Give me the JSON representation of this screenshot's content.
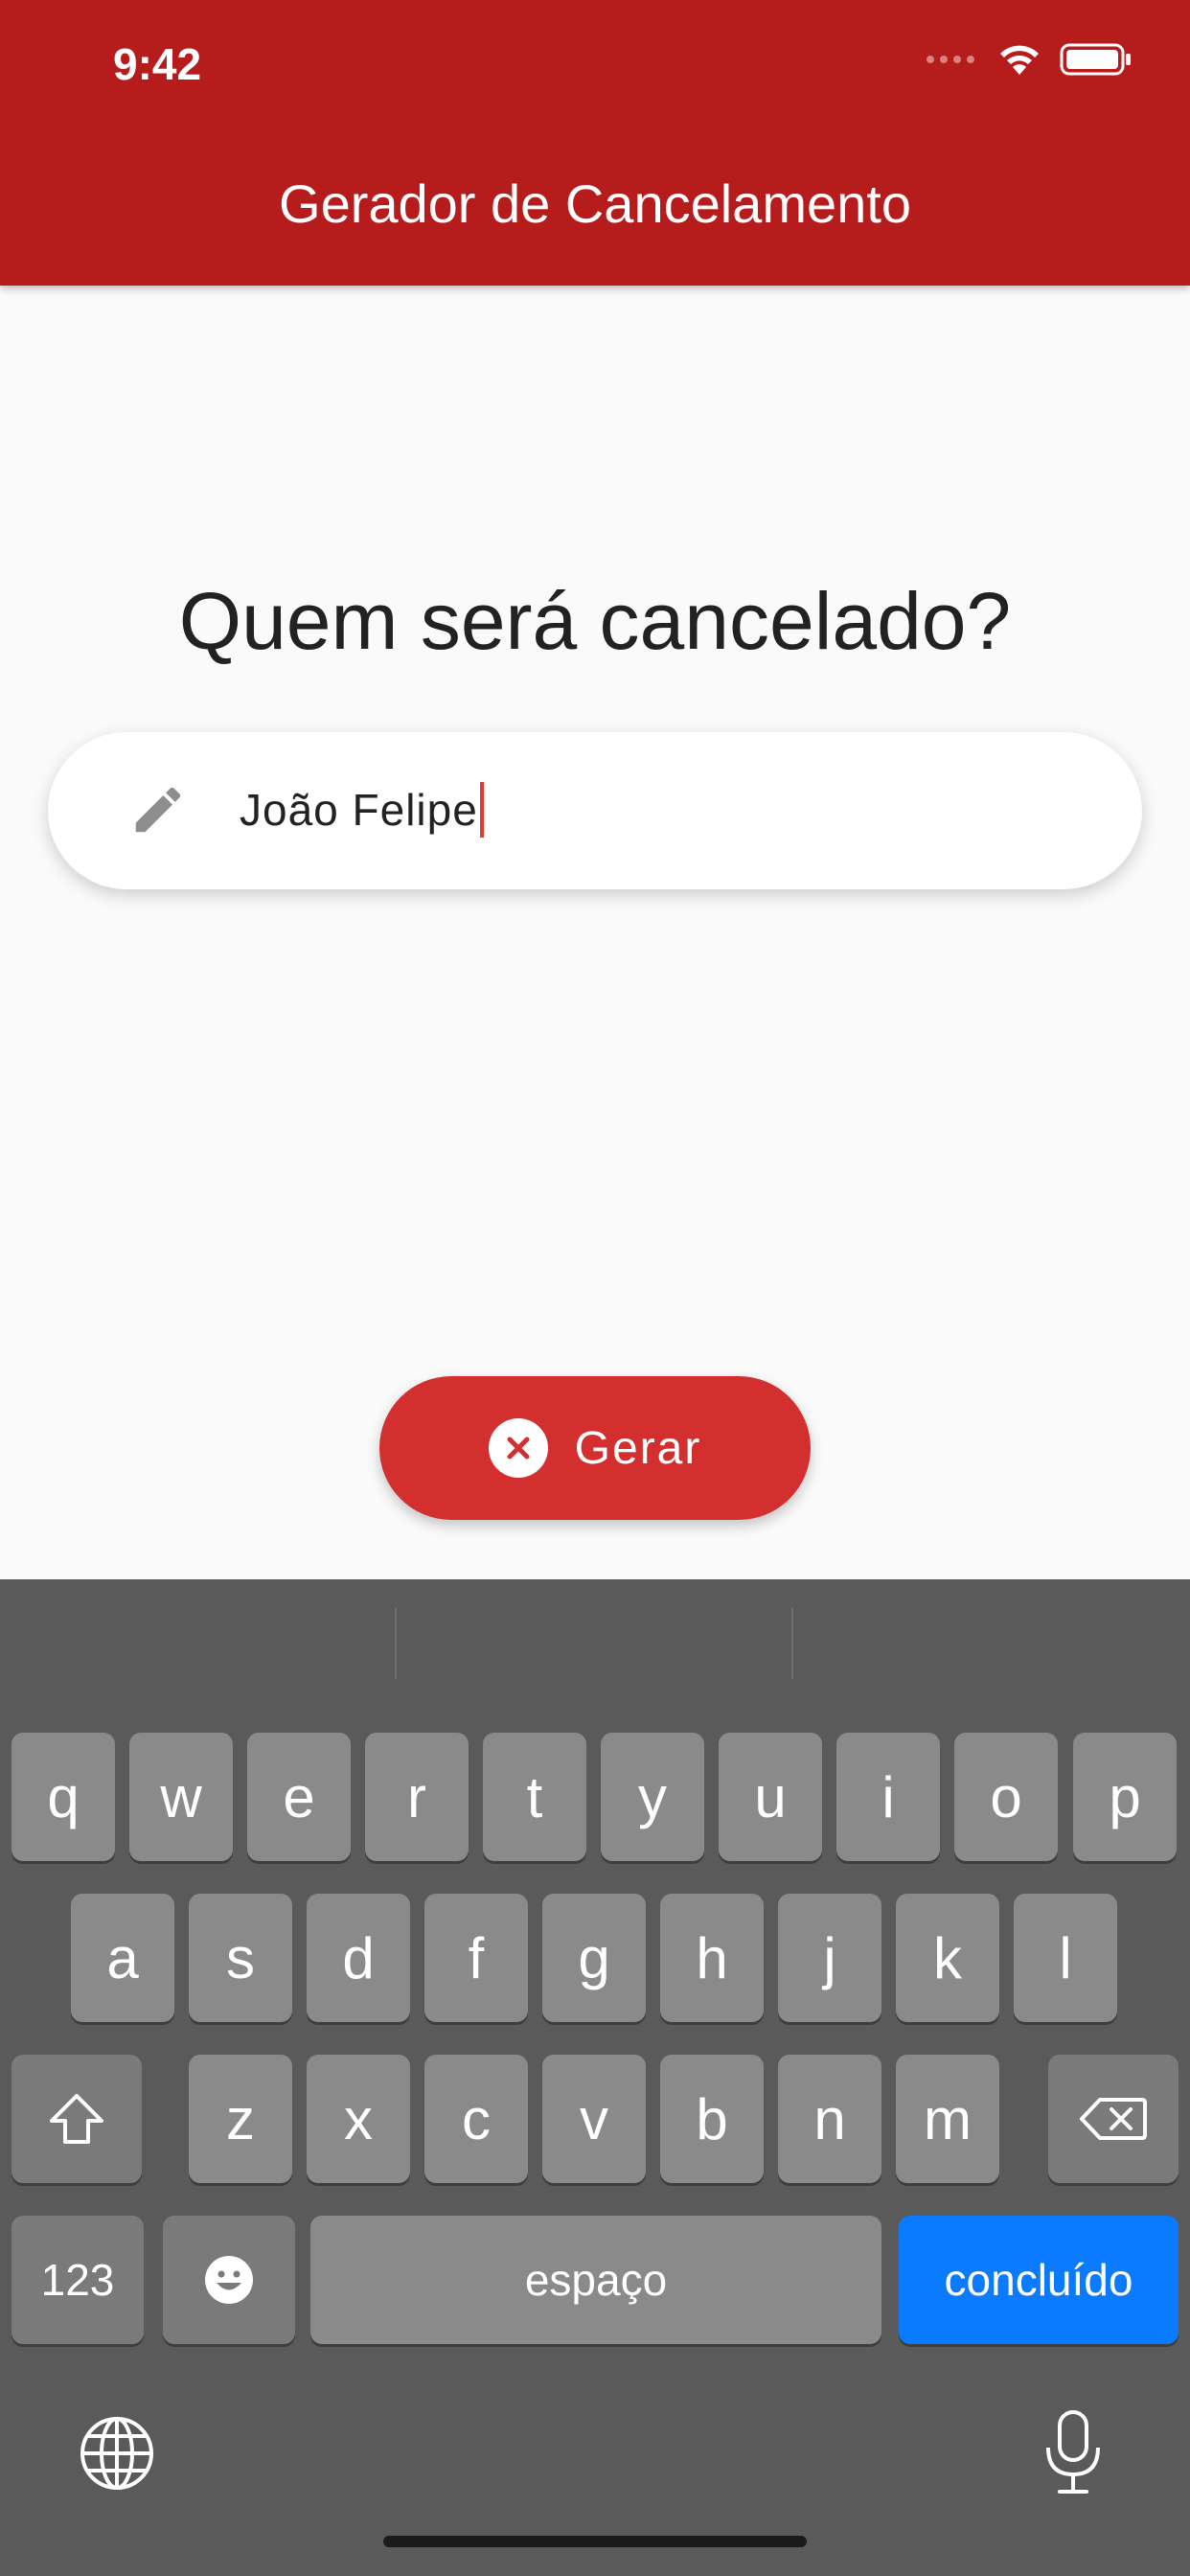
{
  "status_bar": {
    "time": "9:42"
  },
  "app_bar": {
    "title": "Gerador de Cancelamento"
  },
  "main": {
    "question": "Quem será cancelado?",
    "name_input": {
      "value": "João Felipe"
    },
    "generate_button_label": "Gerar"
  },
  "keyboard": {
    "row1": [
      "q",
      "w",
      "e",
      "r",
      "t",
      "y",
      "u",
      "i",
      "o",
      "p"
    ],
    "row2": [
      "a",
      "s",
      "d",
      "f",
      "g",
      "h",
      "j",
      "k",
      "l"
    ],
    "row3": [
      "z",
      "x",
      "c",
      "v",
      "b",
      "n",
      "m"
    ],
    "numbers_label": "123",
    "space_label": "espaço",
    "done_label": "concluído"
  },
  "colors": {
    "app_bar": "#b71c1c",
    "button": "#d32f2f",
    "caret": "#e53935",
    "done_key": "#0a7aff"
  }
}
